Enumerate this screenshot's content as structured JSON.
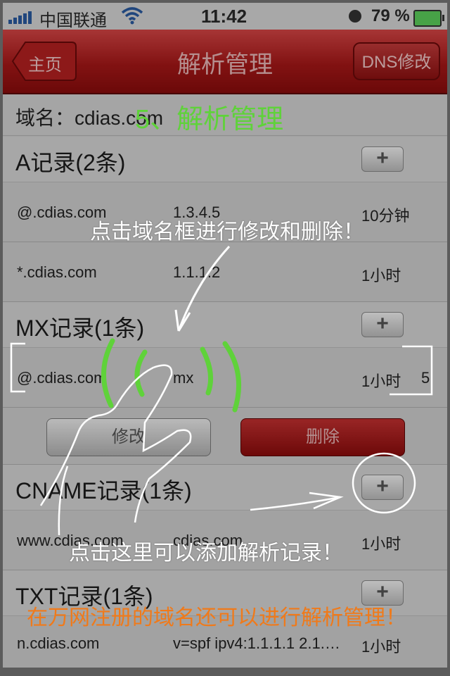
{
  "status_bar": {
    "carrier": "中国联通",
    "time": "11:42",
    "battery": "79 %"
  },
  "nav": {
    "back_label": "主页",
    "title": "解析管理",
    "right_button": "DNS修改"
  },
  "domain": {
    "label": "域名：cdias.com"
  },
  "sections": [
    {
      "title": "A记录(2条)",
      "add_label": "+",
      "records": [
        {
          "host": "@.cdias.com",
          "value": "1.3.4.5",
          "ttl": "10分钟"
        },
        {
          "host": "*.cdias.com",
          "value": "1.1.1.2",
          "ttl": "1小时"
        }
      ]
    },
    {
      "title": "MX记录(1条)",
      "add_label": "+",
      "records": [
        {
          "host": "@.cdias.com",
          "value": "mx",
          "ttl": "1小时",
          "priority": "5"
        }
      ],
      "actions": {
        "edit": "修改",
        "delete": "删除"
      }
    },
    {
      "title": "CNAME记录(1条)",
      "add_label": "+",
      "records": [
        {
          "host": "www.cdias.com",
          "value": "cdias.com",
          "ttl": "1小时"
        }
      ]
    },
    {
      "title": "TXT记录(1条)",
      "add_label": "+",
      "records": [
        {
          "host": "n.cdias.com",
          "value": "v=spf ipv4:1.1.1.1 2.1.…",
          "ttl": "1小时"
        }
      ]
    }
  ],
  "annotations": {
    "step": "5、解析管理",
    "tap_domain": "点击域名框进行修改和删除！",
    "tap_add": "点击这里可以添加解析记录！",
    "footer": "在万网注册的域名还可以进行解析管理！"
  },
  "colors": {
    "nav_red": "#a71818",
    "annotation_green": "#5fd23a",
    "annotation_orange": "#f07a1a",
    "delete_red": "#8c0c0c"
  }
}
